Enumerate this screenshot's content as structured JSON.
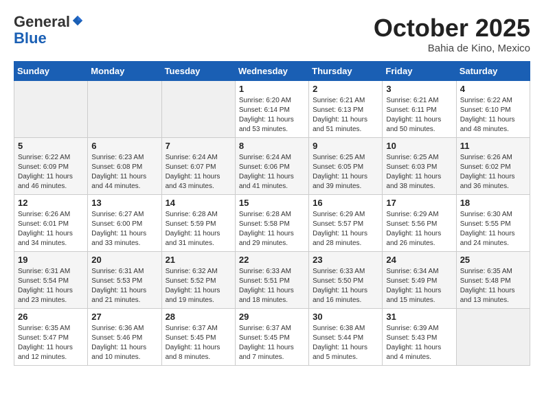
{
  "header": {
    "logo_general": "General",
    "logo_blue": "Blue",
    "month": "October 2025",
    "location": "Bahia de Kino, Mexico"
  },
  "days_of_week": [
    "Sunday",
    "Monday",
    "Tuesday",
    "Wednesday",
    "Thursday",
    "Friday",
    "Saturday"
  ],
  "weeks": [
    [
      {
        "day": "",
        "info": ""
      },
      {
        "day": "",
        "info": ""
      },
      {
        "day": "",
        "info": ""
      },
      {
        "day": "1",
        "info": "Sunrise: 6:20 AM\nSunset: 6:14 PM\nDaylight: 11 hours\nand 53 minutes."
      },
      {
        "day": "2",
        "info": "Sunrise: 6:21 AM\nSunset: 6:13 PM\nDaylight: 11 hours\nand 51 minutes."
      },
      {
        "day": "3",
        "info": "Sunrise: 6:21 AM\nSunset: 6:11 PM\nDaylight: 11 hours\nand 50 minutes."
      },
      {
        "day": "4",
        "info": "Sunrise: 6:22 AM\nSunset: 6:10 PM\nDaylight: 11 hours\nand 48 minutes."
      }
    ],
    [
      {
        "day": "5",
        "info": "Sunrise: 6:22 AM\nSunset: 6:09 PM\nDaylight: 11 hours\nand 46 minutes."
      },
      {
        "day": "6",
        "info": "Sunrise: 6:23 AM\nSunset: 6:08 PM\nDaylight: 11 hours\nand 44 minutes."
      },
      {
        "day": "7",
        "info": "Sunrise: 6:24 AM\nSunset: 6:07 PM\nDaylight: 11 hours\nand 43 minutes."
      },
      {
        "day": "8",
        "info": "Sunrise: 6:24 AM\nSunset: 6:06 PM\nDaylight: 11 hours\nand 41 minutes."
      },
      {
        "day": "9",
        "info": "Sunrise: 6:25 AM\nSunset: 6:05 PM\nDaylight: 11 hours\nand 39 minutes."
      },
      {
        "day": "10",
        "info": "Sunrise: 6:25 AM\nSunset: 6:03 PM\nDaylight: 11 hours\nand 38 minutes."
      },
      {
        "day": "11",
        "info": "Sunrise: 6:26 AM\nSunset: 6:02 PM\nDaylight: 11 hours\nand 36 minutes."
      }
    ],
    [
      {
        "day": "12",
        "info": "Sunrise: 6:26 AM\nSunset: 6:01 PM\nDaylight: 11 hours\nand 34 minutes."
      },
      {
        "day": "13",
        "info": "Sunrise: 6:27 AM\nSunset: 6:00 PM\nDaylight: 11 hours\nand 33 minutes."
      },
      {
        "day": "14",
        "info": "Sunrise: 6:28 AM\nSunset: 5:59 PM\nDaylight: 11 hours\nand 31 minutes."
      },
      {
        "day": "15",
        "info": "Sunrise: 6:28 AM\nSunset: 5:58 PM\nDaylight: 11 hours\nand 29 minutes."
      },
      {
        "day": "16",
        "info": "Sunrise: 6:29 AM\nSunset: 5:57 PM\nDaylight: 11 hours\nand 28 minutes."
      },
      {
        "day": "17",
        "info": "Sunrise: 6:29 AM\nSunset: 5:56 PM\nDaylight: 11 hours\nand 26 minutes."
      },
      {
        "day": "18",
        "info": "Sunrise: 6:30 AM\nSunset: 5:55 PM\nDaylight: 11 hours\nand 24 minutes."
      }
    ],
    [
      {
        "day": "19",
        "info": "Sunrise: 6:31 AM\nSunset: 5:54 PM\nDaylight: 11 hours\nand 23 minutes."
      },
      {
        "day": "20",
        "info": "Sunrise: 6:31 AM\nSunset: 5:53 PM\nDaylight: 11 hours\nand 21 minutes."
      },
      {
        "day": "21",
        "info": "Sunrise: 6:32 AM\nSunset: 5:52 PM\nDaylight: 11 hours\nand 19 minutes."
      },
      {
        "day": "22",
        "info": "Sunrise: 6:33 AM\nSunset: 5:51 PM\nDaylight: 11 hours\nand 18 minutes."
      },
      {
        "day": "23",
        "info": "Sunrise: 6:33 AM\nSunset: 5:50 PM\nDaylight: 11 hours\nand 16 minutes."
      },
      {
        "day": "24",
        "info": "Sunrise: 6:34 AM\nSunset: 5:49 PM\nDaylight: 11 hours\nand 15 minutes."
      },
      {
        "day": "25",
        "info": "Sunrise: 6:35 AM\nSunset: 5:48 PM\nDaylight: 11 hours\nand 13 minutes."
      }
    ],
    [
      {
        "day": "26",
        "info": "Sunrise: 6:35 AM\nSunset: 5:47 PM\nDaylight: 11 hours\nand 12 minutes."
      },
      {
        "day": "27",
        "info": "Sunrise: 6:36 AM\nSunset: 5:46 PM\nDaylight: 11 hours\nand 10 minutes."
      },
      {
        "day": "28",
        "info": "Sunrise: 6:37 AM\nSunset: 5:45 PM\nDaylight: 11 hours\nand 8 minutes."
      },
      {
        "day": "29",
        "info": "Sunrise: 6:37 AM\nSunset: 5:45 PM\nDaylight: 11 hours\nand 7 minutes."
      },
      {
        "day": "30",
        "info": "Sunrise: 6:38 AM\nSunset: 5:44 PM\nDaylight: 11 hours\nand 5 minutes."
      },
      {
        "day": "31",
        "info": "Sunrise: 6:39 AM\nSunset: 5:43 PM\nDaylight: 11 hours\nand 4 minutes."
      },
      {
        "day": "",
        "info": ""
      }
    ]
  ]
}
